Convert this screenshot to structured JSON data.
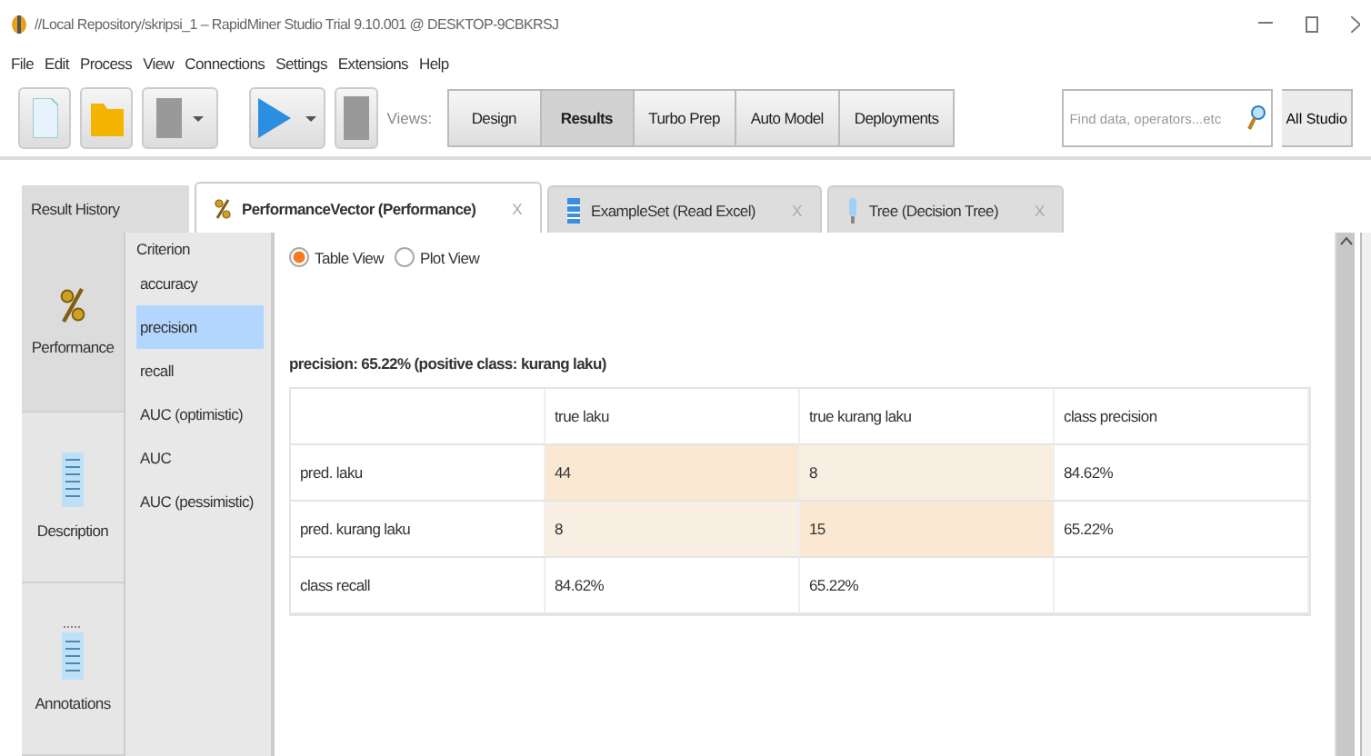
{
  "window": {
    "title": "//Local Repository/skripsi_1 – RapidMiner Studio Trial 9.10.001 @ DESKTOP-9CBKRSJ"
  },
  "menu": [
    "File",
    "Edit",
    "Process",
    "View",
    "Connections",
    "Settings",
    "Extensions",
    "Help"
  ],
  "views": {
    "label": "Views:",
    "buttons": [
      {
        "label": "Design",
        "selected": false
      },
      {
        "label": "Results",
        "selected": true
      },
      {
        "label": "Turbo Prep",
        "selected": false
      },
      {
        "label": "Auto Model",
        "selected": false
      },
      {
        "label": "Deployments",
        "selected": false
      }
    ]
  },
  "search": {
    "placeholder": "Find data, operators...etc",
    "scope": "All Studio"
  },
  "result_history": "Result History",
  "tabs": [
    {
      "label": "PerformanceVector (Performance)",
      "selected": true,
      "kind": "performance",
      "close": "X"
    },
    {
      "label": "ExampleSet (Read Excel)",
      "selected": false,
      "kind": "table",
      "close": "X"
    },
    {
      "label": "Tree (Decision Tree)",
      "selected": false,
      "kind": "tree",
      "close": "X"
    }
  ],
  "side_views": [
    {
      "label": "Performance",
      "selected": true,
      "kind": "percent"
    },
    {
      "label": "Description",
      "selected": false,
      "kind": "document"
    },
    {
      "label": "Annotations",
      "selected": false,
      "kind": "notes"
    }
  ],
  "criterion": {
    "title": "Criterion",
    "items": [
      {
        "label": "accuracy",
        "selected": false
      },
      {
        "label": "precision",
        "selected": true
      },
      {
        "label": "recall",
        "selected": false
      },
      {
        "label": "AUC (optimistic)",
        "selected": false
      },
      {
        "label": "AUC",
        "selected": false
      },
      {
        "label": "AUC (pessimistic)",
        "selected": false
      }
    ]
  },
  "view_mode": [
    {
      "label": "Table View",
      "selected": true
    },
    {
      "label": "Plot View",
      "selected": false
    }
  ],
  "summary": "precision: 65.22% (positive class: kurang laku)",
  "table": {
    "columns": [
      "true laku",
      "true kurang laku",
      "class precision"
    ],
    "rows": [
      {
        "label": "pred. laku",
        "cells": [
          {
            "text": "44",
            "color": "#fae8d2"
          },
          {
            "text": "8",
            "color": "#f8efe2"
          },
          {
            "text": "84.62%",
            "color": "#ffffff"
          }
        ]
      },
      {
        "label": "pred. kurang laku",
        "cells": [
          {
            "text": "8",
            "color": "#f8efe2"
          },
          {
            "text": "15",
            "color": "#fae8d2"
          },
          {
            "text": "65.22%",
            "color": "#ffffff"
          }
        ]
      },
      {
        "label": "class recall",
        "cells": [
          {
            "text": "84.62%",
            "color": "#ffffff"
          },
          {
            "text": "65.22%",
            "color": "#ffffff"
          },
          {
            "text": "",
            "color": "#ffffff"
          }
        ]
      }
    ]
  }
}
